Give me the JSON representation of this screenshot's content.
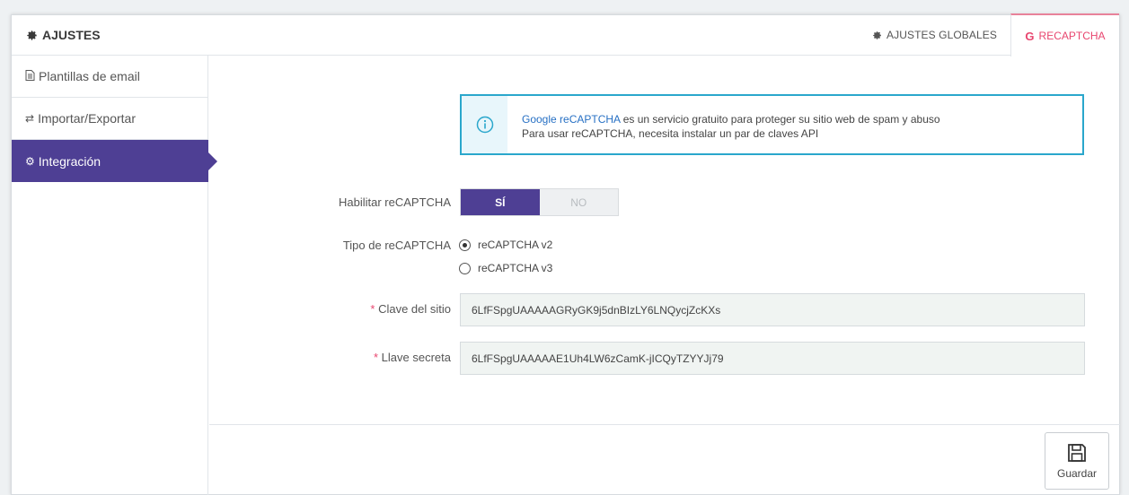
{
  "header": {
    "title": "AJUSTES",
    "tabs": [
      {
        "label": "AJUSTES GLOBALES",
        "icon": "gear-icon"
      },
      {
        "label": "RECAPTCHA",
        "icon": "google-g-icon",
        "active": true
      }
    ]
  },
  "sidebar": {
    "items": [
      {
        "label": "Plantillas de email",
        "icon": "document-icon"
      },
      {
        "label": "Importar/Exportar",
        "icon": "exchange-icon"
      },
      {
        "label": "Integración",
        "icon": "gears-icon",
        "active": true
      }
    ]
  },
  "info": {
    "link_text": "Google reCAPTCHA",
    "line1_rest": " es un servicio gratuito para proteger su sitio web de spam y abuso",
    "line2": "Para usar reCAPTCHA, necesita instalar un par de claves API",
    "icon": "info-icon"
  },
  "form": {
    "enable_label": "Habilitar reCAPTCHA",
    "toggle_yes": "SÍ",
    "toggle_no": "NO",
    "toggle_value": "SÍ",
    "type_label": "Tipo de reCAPTCHA",
    "type_options": [
      "reCAPTCHA v2",
      "reCAPTCHA v3"
    ],
    "type_selected": "reCAPTCHA v2",
    "required_mark": "*",
    "site_key_label": "Clave del sitio",
    "site_key_value": "6LfFSpgUAAAAAGRyGK9j5dnBIzLY6LNQycjZcKXs",
    "secret_key_label": "Llave secreta",
    "secret_key_value": "6LfFSpgUAAAAAE1Uh4LW6zCamK-jICQyTZYYJj79"
  },
  "footer": {
    "save_label": "Guardar",
    "save_icon": "floppy-disk-icon"
  },
  "colors": {
    "accent": "#4e3f94",
    "active_tab": "#e8466f",
    "info_border": "#2aa7cc"
  }
}
